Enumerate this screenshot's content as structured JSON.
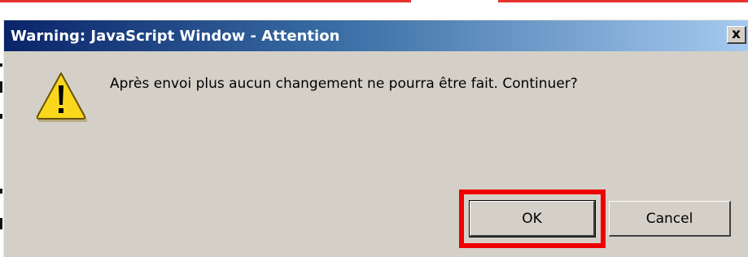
{
  "dialog": {
    "title": "Warning: JavaScript Window - Attention",
    "close_glyph": "x",
    "icon": "warning-triangle-icon",
    "message": "Après envoi plus aucun changement ne pourra être fait. Continuer?",
    "buttons": {
      "ok_label": "OK",
      "cancel_label": "Cancel"
    },
    "highlighted_button": "OK"
  },
  "colors": {
    "title_gradient_start": "#0a246a",
    "title_gradient_end": "#a6caf0",
    "dialog_face": "#d4d0c8",
    "highlight": "#ee0000",
    "warning_yellow": "#f9d71c"
  }
}
